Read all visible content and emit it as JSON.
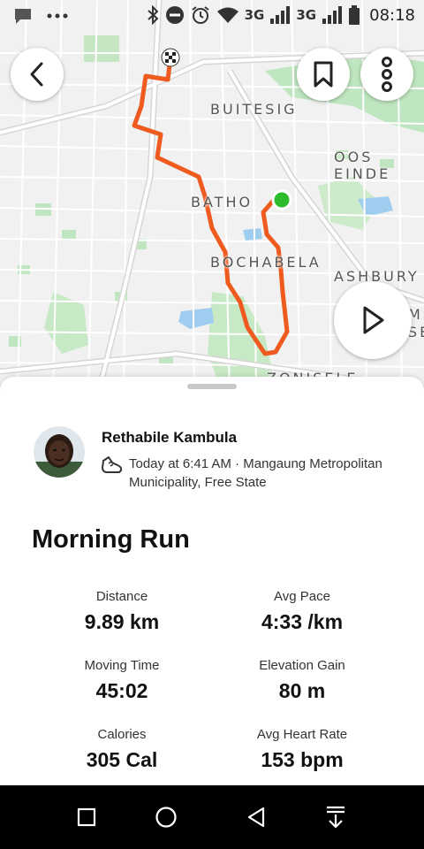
{
  "status_bar": {
    "network_1": "3G",
    "network_2": "3G",
    "time": "08:18",
    "icons": [
      "chat-bubble-icon",
      "more-dots-icon",
      "bluetooth-icon",
      "do-not-disturb-icon",
      "alarm-icon",
      "wifi-icon",
      "signal-icon",
      "signal-icon",
      "battery-icon"
    ]
  },
  "map": {
    "labels": {
      "buitesig": "BUITESIG",
      "oos_einde": "OOS EINDE",
      "batho": "BATHO",
      "bochabela": "BOCHABELA",
      "ashbury": "ASHBURY",
      "zonisele": "ZONISELE",
      "ms": "MS",
      "se": "SE"
    },
    "route_color": "#ef5a1f",
    "start_marker_color": "#2bbb2b"
  },
  "toolbar": {
    "back_icon": "chevron-left-icon",
    "bookmark_icon": "bookmark-icon",
    "more_icon": "more-vertical-icon",
    "play_icon": "play-icon"
  },
  "athlete": {
    "name": "Rethabile Kambula",
    "meta": "Today at 6:41 AM · Mangaung Metropolitan Municipality, Free State",
    "activity_icon": "running-shoe-icon"
  },
  "activity": {
    "title": "Morning Run",
    "stats": [
      {
        "label": "Distance",
        "value": "9.89 km"
      },
      {
        "label": "Avg Pace",
        "value": "4:33 /km"
      },
      {
        "label": "Moving Time",
        "value": "45:02"
      },
      {
        "label": "Elevation Gain",
        "value": "80 m"
      },
      {
        "label": "Calories",
        "value": "305 Cal"
      },
      {
        "label": "Avg Heart Rate",
        "value": "153 bpm"
      }
    ]
  },
  "nav_bar": {
    "icons": [
      "recents-square-icon",
      "home-circle-icon",
      "back-triangle-icon",
      "notification-pull-down-icon"
    ]
  }
}
